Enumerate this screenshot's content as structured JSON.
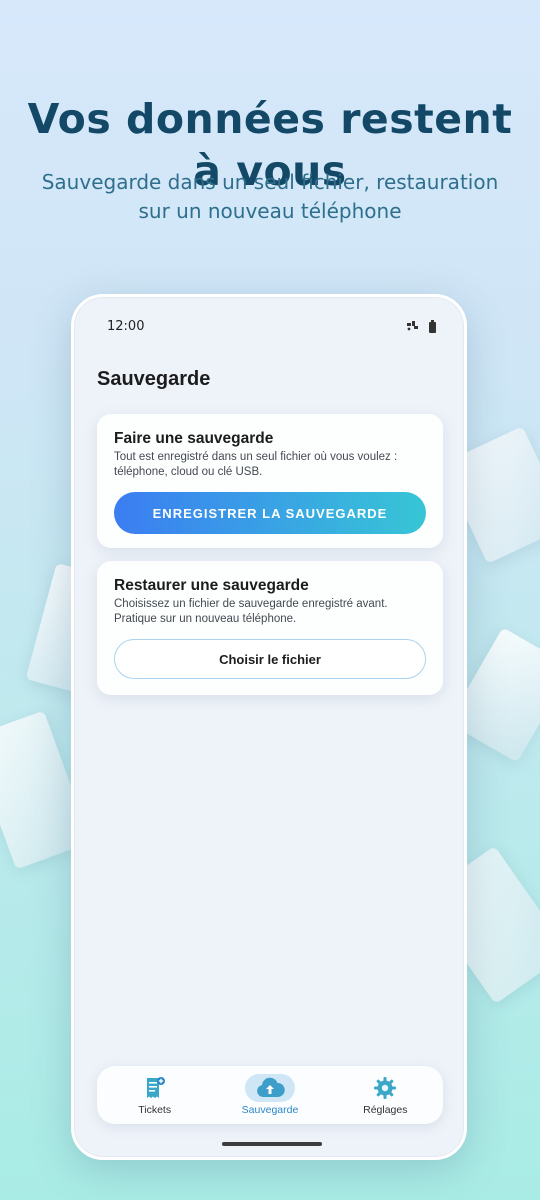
{
  "hero": {
    "title": "Vos données restent à vous",
    "subtitle": "Sauvegarde dans un seul fichier, restauration sur un nouveau téléphone"
  },
  "status_bar": {
    "time": "12:00",
    "icons": [
      "satellite-icon",
      "battery-icon"
    ]
  },
  "screen": {
    "title": "Sauvegarde"
  },
  "backup_card": {
    "title": "Faire une sauvegarde",
    "description": "Tout est enregistré dans un seul fichier où vous voulez : téléphone, cloud ou clé USB.",
    "button_label": "ENREGISTRER LA SAUVEGARDE"
  },
  "restore_card": {
    "title": "Restaurer une sauvegarde",
    "description": "Choisissez un fichier de sauvegarde enregistré avant. Pratique sur un nouveau téléphone.",
    "button_label": "Choisir le fichier"
  },
  "nav": {
    "items": [
      {
        "label": "Tickets",
        "icon": "receipt-icon",
        "active": false
      },
      {
        "label": "Sauvegarde",
        "icon": "cloud-upload-icon",
        "active": true
      },
      {
        "label": "Réglages",
        "icon": "gear-icon",
        "active": false
      }
    ]
  },
  "colors": {
    "title": "#134867",
    "primary_gradient_start": "#3b7df2",
    "primary_gradient_end": "#37c6d6",
    "active_nav": "#2b88c8"
  }
}
